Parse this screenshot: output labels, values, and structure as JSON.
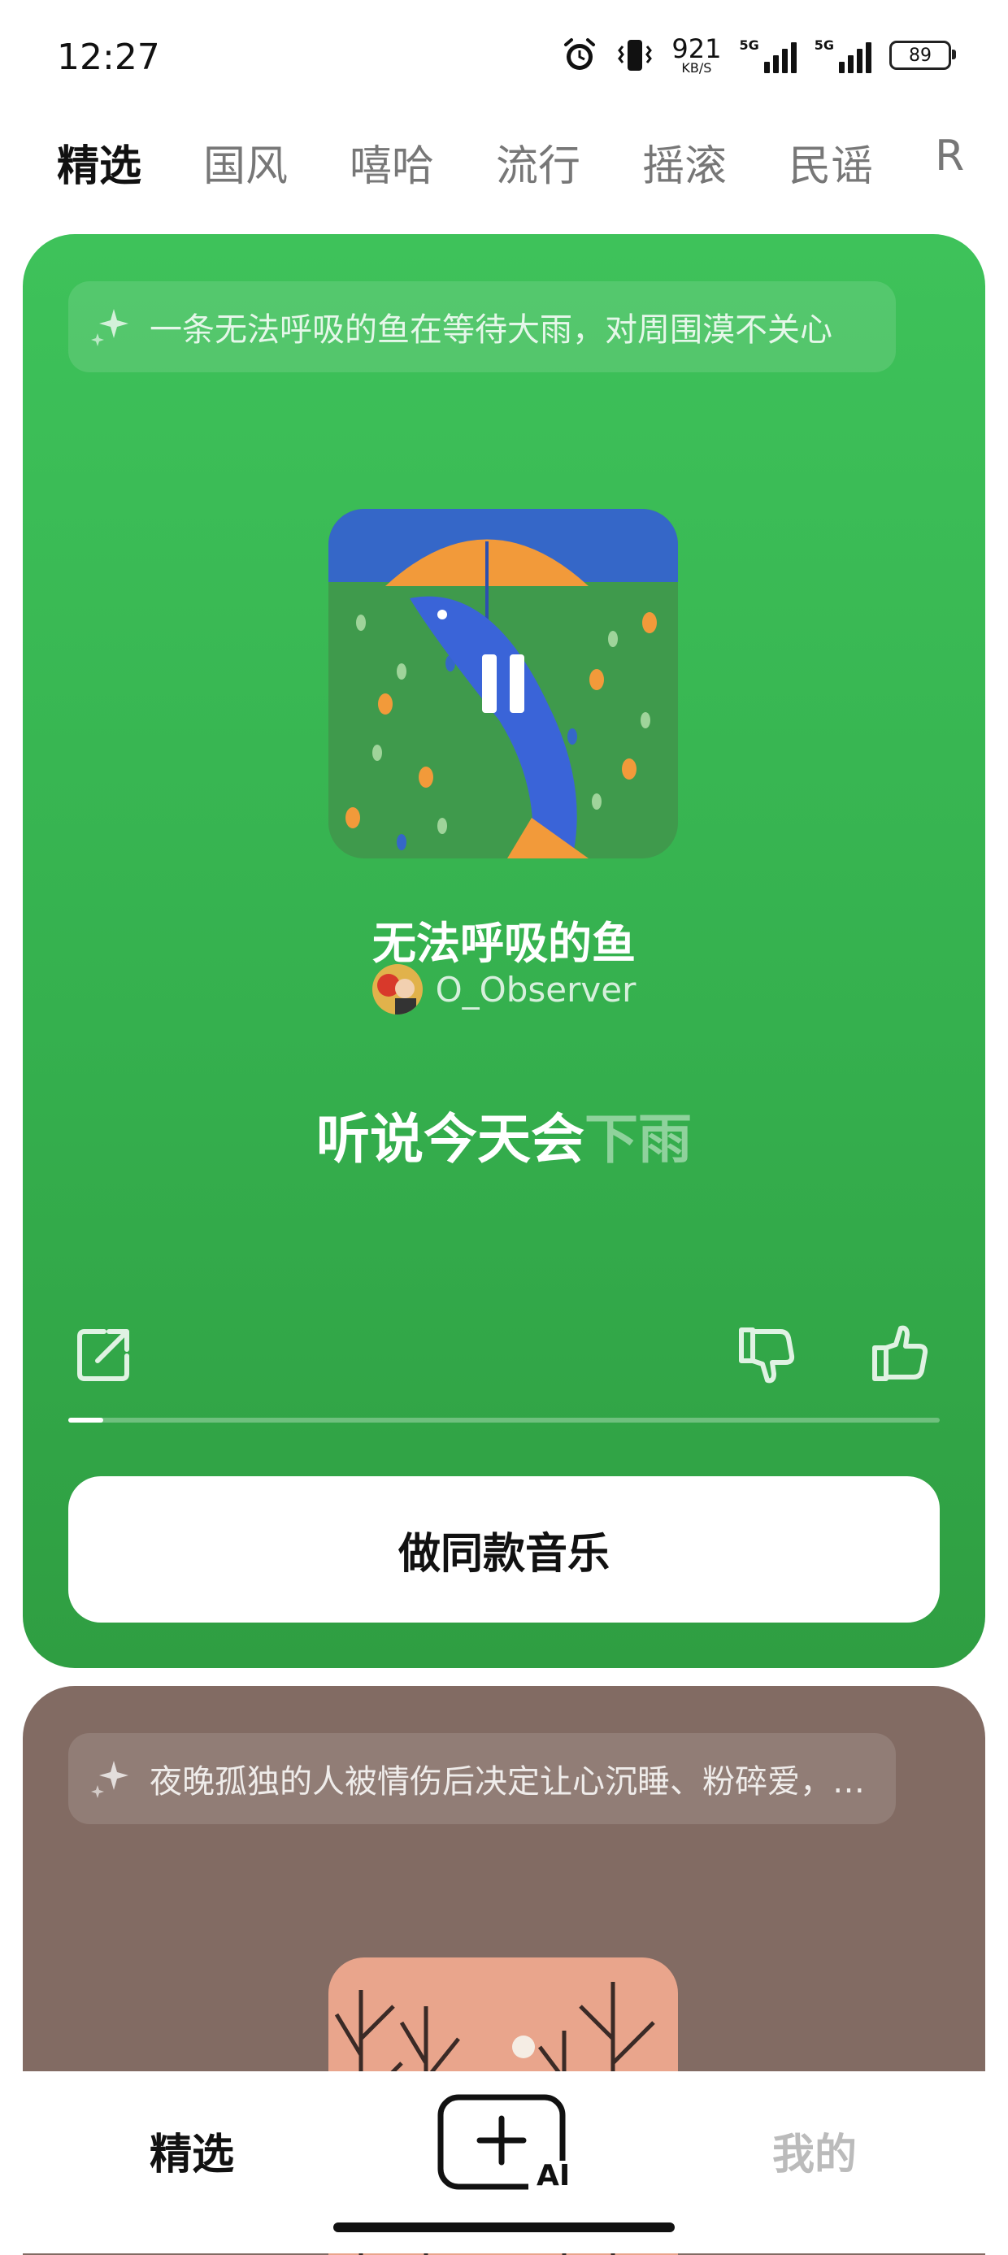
{
  "status_bar": {
    "time": "12:27",
    "net_speed_value": "921",
    "net_speed_unit": "KB/S",
    "signal1_tag": "5G",
    "signal2_tag": "5G",
    "battery": "89",
    "icons": [
      "alarm-icon",
      "vibrate-icon",
      "signal-icon",
      "signal-icon",
      "battery-icon"
    ]
  },
  "genre_tabs": {
    "items": [
      "精选",
      "国风",
      "嘻哈",
      "流行",
      "摇滚",
      "民谣",
      "R"
    ],
    "active_index": 0
  },
  "cards": [
    {
      "prompt": "一条无法呼吸的鱼在等待大雨，对周围漠不关心",
      "song_title": "无法呼吸的鱼",
      "author": "O_Observer",
      "lyric_sung": "听说今天会",
      "lyric_upcoming": "下雨",
      "progress_fraction": 0.04,
      "make_button": "做同款音乐",
      "background_color": "#3ec25a"
    },
    {
      "prompt": "夜晚孤独的人被情伤后决定让心沉睡、粉碎爱，…",
      "background_color": "#826b63"
    }
  ],
  "bottom_nav": {
    "left_label": "精选",
    "center_icon_text": "AI",
    "right_label": "我的"
  }
}
